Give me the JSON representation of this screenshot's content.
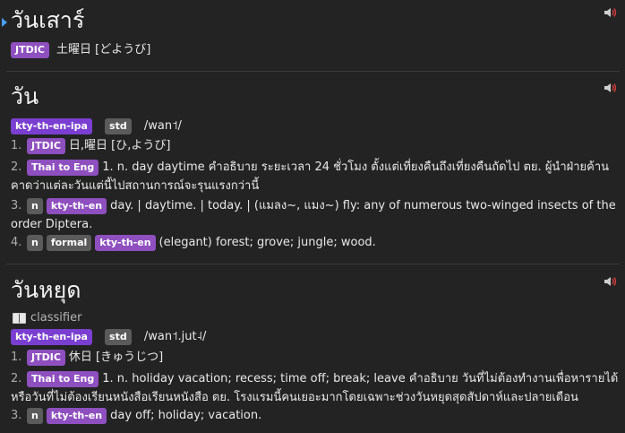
{
  "icons": {
    "speaker": "speaker-icon",
    "marker": "triangle-marker-icon",
    "book": "book-icon"
  },
  "colors": {
    "background": "#232323",
    "tag_purple": "#8e4fbf",
    "tag_violet": "#7a3fd0",
    "tag_grey": "#5b5b5b",
    "marker": "#4aa0ff"
  },
  "entries": [
    {
      "title": "วันเสาร์",
      "tags": [
        "JTDIC"
      ],
      "text": "土曜日 [どようび]"
    },
    {
      "title": "วัน",
      "pron_tags": [
        "kty-th-en-ipa",
        "std"
      ],
      "pron": "/wan˦/",
      "senses": [
        {
          "num": "1.",
          "tags": [
            "JTDIC"
          ],
          "text": "日,曜日 [ひ,ようび]"
        },
        {
          "num": "2.",
          "tags": [
            "Thai to Eng"
          ],
          "text": "1. n. day daytime คำอธิบาย ระยะเวลา 24 ชั่วโมง ตั้งแต่เที่ยงคืนถึงเที่ยงคืนถัดไป ตย. ผู้นำฝ่ายค้านคาดว่าแต่ละวันแต่นี้ไปสถานการณ์จะรุนแรงกว่านี้"
        },
        {
          "num": "3.",
          "tags": [
            "n",
            "kty-th-en"
          ],
          "text": "day. | daytime. | today. | (แมลง~, แมง~) fly: any of numerous two-winged insects of the order Diptera."
        },
        {
          "num": "4.",
          "tags": [
            "n",
            "formal",
            "kty-th-en"
          ],
          "text": "(elegant) forest; grove; jungle; wood."
        }
      ]
    },
    {
      "title": "วันหยุด",
      "classifier": "classifier",
      "pron_tags": [
        "kty-th-en-ipa",
        "std"
      ],
      "pron": "/wan˦.jut˨/",
      "senses": [
        {
          "num": "1.",
          "tags": [
            "JTDIC"
          ],
          "text": "休日 [きゅうじつ]"
        },
        {
          "num": "2.",
          "tags": [
            "Thai to Eng"
          ],
          "text": "1. n. holiday vacation; recess; time off; break; leave คำอธิบาย วันที่ไม่ต้องทำงานเพื่อหารายได้ หรือวันที่ไม่ต้องเรียนหนังสือเรียนหนังสือ ตย. โรงแรมนี้คนเยอะมากโดยเฉพาะช่วงวันหยุดสุดสัปดาห์และปลายเดือน"
        },
        {
          "num": "3.",
          "tags": [
            "n",
            "kty-th-en"
          ],
          "text": "day off; holiday; vacation."
        }
      ]
    }
  ]
}
